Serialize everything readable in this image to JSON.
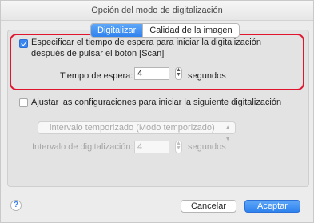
{
  "window": {
    "title": "Opción del modo de digitalización"
  },
  "tabs": [
    {
      "label": "Digitalizar",
      "selected": true
    },
    {
      "label": "Calidad de la imagen",
      "selected": false
    }
  ],
  "option1": {
    "checked": true,
    "line1": "Especificar el tiempo de espera para iniciar la digitalización",
    "line2": "después de pulsar el botón [Scan]",
    "wait_label": "Tiempo de espera:",
    "wait_value": "4",
    "wait_unit": "segundos"
  },
  "option2": {
    "checked": false,
    "label": "Ajustar las configuraciones para iniciar la siguiente digitalización",
    "mode_select": "intervalo temporizado (Modo temporizado)",
    "interval_label": "Intervalo de digitalización:",
    "interval_value": "4",
    "interval_unit": "segundos"
  },
  "footer": {
    "help_symbol": "?",
    "cancel_label": "Cancelar",
    "ok_label": "Aceptar"
  },
  "colors": {
    "accent": "#3b87f1",
    "highlight": "#e0142c"
  }
}
